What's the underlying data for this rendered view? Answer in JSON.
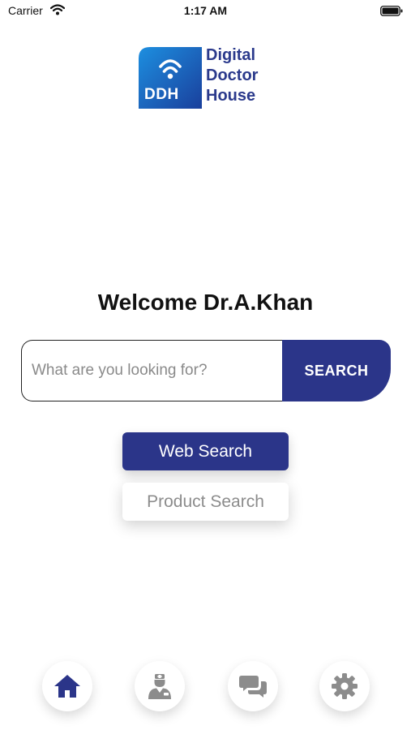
{
  "status_bar": {
    "carrier": "Carrier",
    "time": "1:17 AM"
  },
  "logo": {
    "abbr": "DDH",
    "line1": "Digital",
    "line2": "Doctor",
    "line3": "House"
  },
  "welcome": "Welcome Dr.A.Khan",
  "search": {
    "placeholder": "What are you looking for?",
    "button_label": "SEARCH"
  },
  "modes": {
    "web": "Web Search",
    "product": "Product Search"
  },
  "bottom_nav": [
    {
      "name": "home",
      "icon": "home-icon"
    },
    {
      "name": "doctor",
      "icon": "doctor-icon"
    },
    {
      "name": "chat",
      "icon": "chat-icon"
    },
    {
      "name": "settings",
      "icon": "gear-icon"
    }
  ],
  "colors": {
    "primary": "#2b3589",
    "logo_blue": "#1f7fd6",
    "icon_gray": "#8c8c8c"
  }
}
